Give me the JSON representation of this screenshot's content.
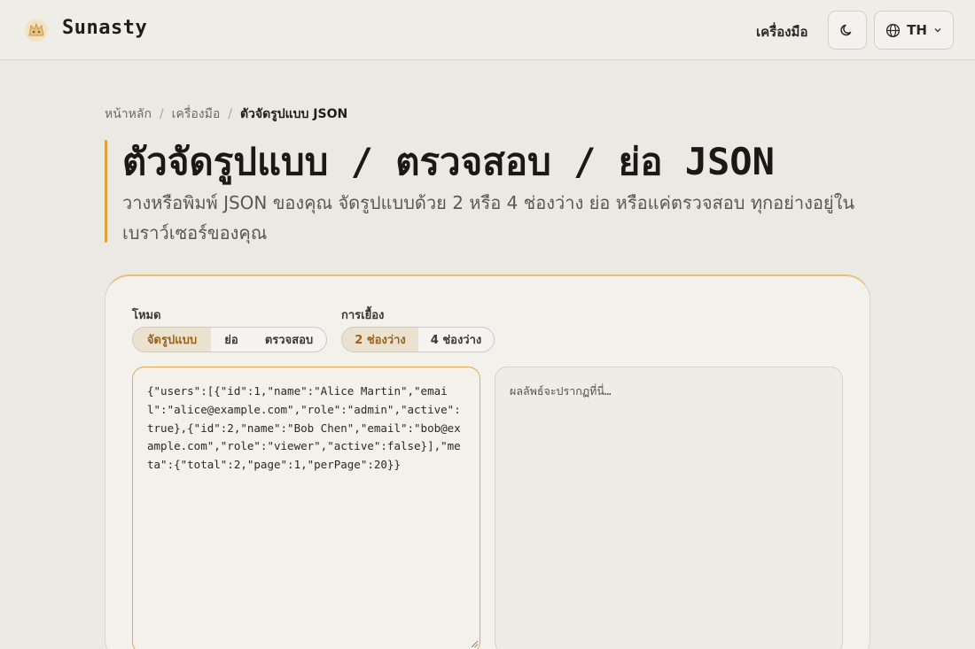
{
  "header": {
    "brand": "Sunasty",
    "nav_tools": "เครื่องมือ",
    "lang_label": "TH",
    "theme_icon": "moon-icon",
    "lang_icon": "globe-icon"
  },
  "breadcrumb": {
    "home": "หน้าหลัก",
    "tools": "เครื่องมือ",
    "current": "ตัวจัดรูปแบบ JSON"
  },
  "page": {
    "title": "ตัวจัดรูปแบบ / ตรวจสอบ / ย่อ JSON",
    "description": "วางหรือพิมพ์ JSON ของคุณ จัดรูปแบบด้วย 2 หรือ 4 ช่องว่าง ย่อ หรือแค่ตรวจสอบ ทุกอย่างอยู่ในเบราว์เซอร์ของคุณ"
  },
  "mode": {
    "label": "โหมด",
    "options": [
      "จัดรูปแบบ",
      "ย่อ",
      "ตรวจสอบ"
    ],
    "selected": "จัดรูปแบบ"
  },
  "indent": {
    "label": "การเยื้อง",
    "options": [
      "2 ช่องว่าง",
      "4 ช่องว่าง"
    ],
    "selected": "2 ช่องว่าง"
  },
  "input": {
    "value": "{\"users\":[{\"id\":1,\"name\":\"Alice Martin\",\"email\":\"alice@example.com\",\"role\":\"admin\",\"active\":true},{\"id\":2,\"name\":\"Bob Chen\",\"email\":\"bob@example.com\",\"role\":\"viewer\",\"active\":false}],\"meta\":{\"total\":2,\"page\":1,\"perPage\":20}}"
  },
  "output": {
    "placeholder": "ผลลัพธ์จะปรากฏที่นี่…"
  },
  "colors": {
    "accent": "#e3a13e",
    "active_segment_bg": "#ebe1cf",
    "active_segment_text": "#9a6219"
  }
}
